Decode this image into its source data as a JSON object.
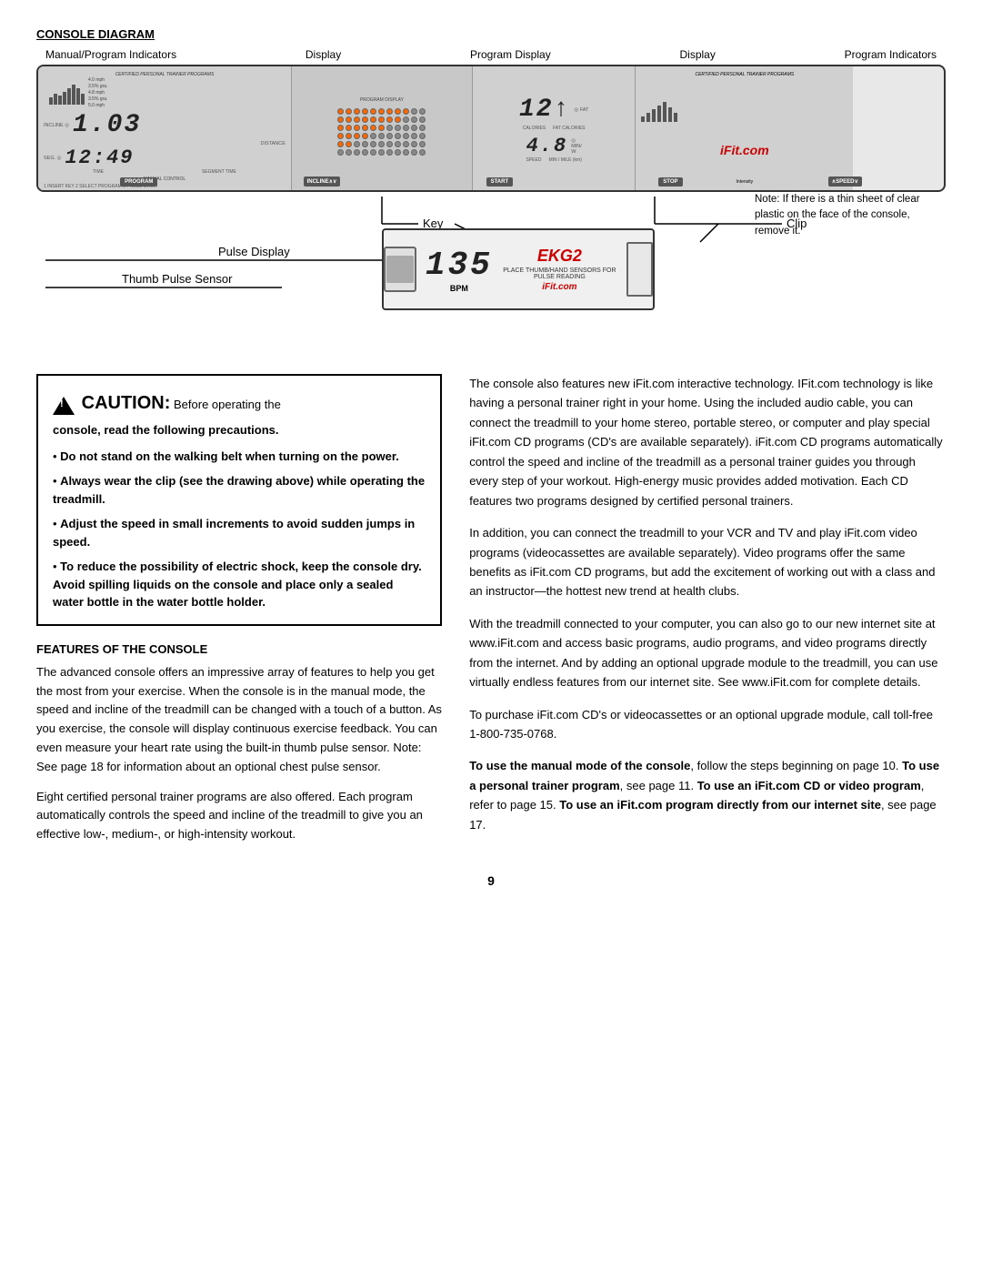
{
  "page": {
    "title": "Console Diagram",
    "section_title": "CONSOLE DIAGRAM"
  },
  "labels": {
    "manual_program_indicators": "Manual/Program Indicators",
    "display1": "Display",
    "program_display": "Program Display",
    "display2": "Display",
    "program_indicators": "Program Indicators",
    "key": "Key",
    "clip": "Clip",
    "pulse_display": "Pulse Display",
    "thumb_pulse_sensor": "Thumb Pulse Sensor"
  },
  "console": {
    "display1": "1.03",
    "display2": "12:49",
    "display3": "12↑",
    "display4": "4.8",
    "ekg_display": "135",
    "bpm": "BPM",
    "ekg_logo": "EKG2",
    "buttons": [
      "PROGRAM",
      "INCLINE",
      "START",
      "STOP",
      "SPEED"
    ]
  },
  "note": {
    "text": "Note: If there is a thin sheet of clear plastic on the face of the console, remove it."
  },
  "caution": {
    "warning_symbol": "⚠",
    "title": "CAUTION:",
    "subtitle": " Before operating the console, read the following precautions.",
    "bold_line": "console, read the following precautions.",
    "bullets": [
      "Do not stand on the walking belt when turning on the power.",
      "Always wear the clip (see the drawing above) while operating the treadmill.",
      "Adjust the speed in small increments to avoid sudden jumps in speed.",
      "To reduce the possibility of electric shock, keep the console dry. Avoid spilling liquids on the console and place only a sealed water bottle in the water bottle holder."
    ]
  },
  "features": {
    "title": "FEATURES OF THE CONSOLE",
    "paragraphs": [
      "The advanced console offers an impressive array of features to help you get the most from your exercise. When the console is in the manual mode, the speed and incline of the treadmill can be changed with a touch of a button. As you exercise, the console will display continuous exercise feedback. You can even measure your heart rate using the built-in thumb pulse sensor. Note: See page 18 for information about an optional chest pulse sensor.",
      "Eight certified personal trainer programs are also offered. Each program automatically controls the speed and incline of the treadmill to give you an effective low-, medium-, or high-intensity workout."
    ]
  },
  "right_column": {
    "paragraphs": [
      "The console also features new iFit.com interactive technology. IFit.com technology is like having a personal trainer right in your home. Using the included audio cable, you can connect the treadmill to your home stereo, portable stereo, or computer and play special iFit.com CD programs (CD's are available separately). iFit.com CD programs automatically control the speed and incline of the treadmill as a personal trainer guides you through every step of your workout. High-energy music provides added motivation. Each CD features two programs designed by certified personal trainers.",
      "In addition, you can connect the treadmill to your VCR and TV and play iFit.com video programs (videocassettes are available separately). Video programs offer the same benefits as iFit.com CD programs, but add the excitement of working out with a class and an instructor—the hottest new trend at health clubs.",
      "With the treadmill connected to your computer, you can also go to our new internet site at www.iFit.com and access basic programs, audio programs, and video programs directly from the internet. And by adding an optional upgrade module to the treadmill, you can use virtually endless features from our internet site. See www.iFit.com for complete details.",
      "To purchase iFit.com CD's or videocassettes or an optional upgrade module, call toll-free 1-800-735-0768."
    ],
    "final_paragraph_parts": [
      {
        "text": "To use the manual mode of the console",
        "bold": true
      },
      {
        "text": ", follow the steps beginning on page 10. ",
        "bold": false
      },
      {
        "text": "To use a personal trainer program",
        "bold": true
      },
      {
        "text": ", see page 11. ",
        "bold": false
      },
      {
        "text": "To use an iFit.com CD or video program",
        "bold": true
      },
      {
        "text": ", refer to page 15. ",
        "bold": false
      },
      {
        "text": "To use an iFit.com program directly from our internet site",
        "bold": true
      },
      {
        "text": ", see page 17.",
        "bold": false
      }
    ]
  },
  "page_number": "9"
}
